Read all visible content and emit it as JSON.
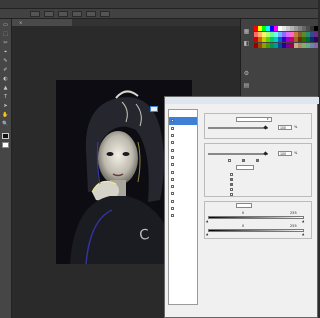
{
  "menu": {
    "title": ""
  },
  "options": {
    "buttons": [
      "",
      "",
      "",
      "",
      "",
      ""
    ]
  },
  "document_tab": {
    "label": "",
    "close": "×"
  },
  "tools": [
    "▭",
    "⬚",
    "✂",
    "⌖",
    "✎",
    "✐",
    "◐",
    "▲",
    "T",
    "➤",
    "✋",
    "🔍"
  ],
  "swatch_colors": [
    "#ff0000",
    "#ffff00",
    "#00ff00",
    "#00ffff",
    "#0000ff",
    "#ff00ff",
    "#ffffff",
    "#e6e6e6",
    "#cccccc",
    "#b3b3b3",
    "#999999",
    "#808080",
    "#666666",
    "#4d4d4d",
    "#333333",
    "#000000",
    "#ff6b6b",
    "#ffb26b",
    "#fff06b",
    "#b8ff6b",
    "#6bff8a",
    "#6bffe6",
    "#6bb4ff",
    "#8a6bff",
    "#d66bff",
    "#ff6bc9",
    "#c97a3d",
    "#8a5a2b",
    "#5a8a2b",
    "#2b8a6b",
    "#2b4f8a",
    "#6b2b8a",
    "#cc0000",
    "#cc6600",
    "#cccc00",
    "#66cc00",
    "#00cc66",
    "#00cccc",
    "#0066cc",
    "#3300cc",
    "#9900cc",
    "#cc0066",
    "#996633",
    "#663300",
    "#336600",
    "#006633",
    "#003366",
    "#330066",
    "#990000",
    "#994c00",
    "#999900",
    "#4c9900",
    "#00994c",
    "#009999",
    "#004c99",
    "#260099",
    "#730099",
    "#99004c",
    "#ccaa88",
    "#aa8866",
    "#88aa66",
    "#66aa88",
    "#6688aa",
    "#8866aa"
  ],
  "right_icons": [
    "▦",
    "◧",
    "⚙",
    "▤"
  ],
  "dialog": {
    "title": "",
    "style_items": [
      {
        "label": "",
        "checked": false,
        "selected": false
      },
      {
        "label": "",
        "checked": false,
        "selected": true
      },
      {
        "label": "",
        "checked": false,
        "selected": false
      },
      {
        "label": "",
        "checked": false,
        "selected": false
      },
      {
        "label": "",
        "checked": false,
        "selected": false
      },
      {
        "label": "",
        "checked": false,
        "selected": false
      },
      {
        "label": "",
        "checked": false,
        "selected": false
      },
      {
        "label": "",
        "checked": false,
        "selected": false
      },
      {
        "label": "",
        "checked": false,
        "selected": false
      },
      {
        "label": "",
        "checked": false,
        "selected": false
      },
      {
        "label": "",
        "checked": false,
        "selected": false
      },
      {
        "label": "",
        "checked": false,
        "selected": false
      },
      {
        "label": "",
        "checked": false,
        "selected": false
      },
      {
        "label": "",
        "checked": false,
        "selected": false
      },
      {
        "label": "",
        "checked": false,
        "selected": false
      }
    ],
    "opacity_value": "100",
    "opacity_unit": "%",
    "fill_opacity_value": "100",
    "fill_opacity_unit": "%",
    "blend_if_this_layer_low": "0",
    "blend_if_this_layer_high": "255",
    "blend_if_underlying_low": "0",
    "blend_if_underlying_high": "255"
  }
}
